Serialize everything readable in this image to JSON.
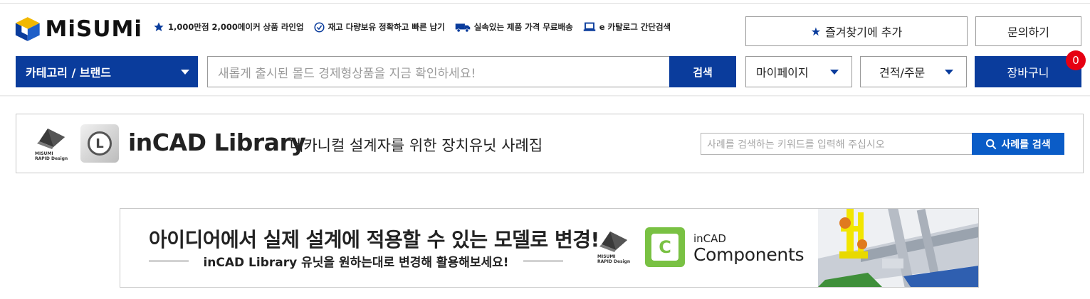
{
  "header": {
    "logo_text": "MiSUMi",
    "features": [
      {
        "icon": "star-icon",
        "label": "1,000만점 2,000메이커 상품 라인업"
      },
      {
        "icon": "check-circle-icon",
        "label": "재고 다량보유 정확하고 빠른 납기"
      },
      {
        "icon": "truck-icon",
        "label": "실속있는 제품 가격 무료배송"
      },
      {
        "icon": "laptop-icon",
        "label": "e 카탈로그 간단검색"
      }
    ],
    "favorite_label": "즐겨찾기에 추가",
    "contact_label": "문의하기",
    "category_label": "카테고리 / 브랜드",
    "search_placeholder": "새롭게 출시된 몰드 경제형상품을 지금 확인하세요!",
    "search_button": "검색",
    "mypage_label": "마이페이지",
    "quote_label": "견적/주문",
    "cart_label": "장바구니",
    "cart_count": "0"
  },
  "incad": {
    "rapid_brand": "MISUMI",
    "rapid_design": "RAPID Design",
    "title": "inCAD Library",
    "subtitle": "메카니컬 설계자를 위한 장치유닛 사례집",
    "search_placeholder": "사례를 검색하는 키워드를 입력해 주십시오",
    "search_button": "사례를 검색"
  },
  "promo": {
    "title": "아이디어에서 실제 설계에 적용할 수 있는 모델로 변경!",
    "subtitle": "inCAD Library 유닛을 원하는대로 변경해 활용해보세요!",
    "rapid_brand": "MISUMI",
    "rapid_design": "RAPID Design",
    "brand_small": "inCAD",
    "brand_big": "Components"
  },
  "colors": {
    "brand_blue": "#0a3c9c",
    "button_blue": "#0a5cc7",
    "badge_red": "#e60012",
    "incad_green": "#79c143"
  }
}
